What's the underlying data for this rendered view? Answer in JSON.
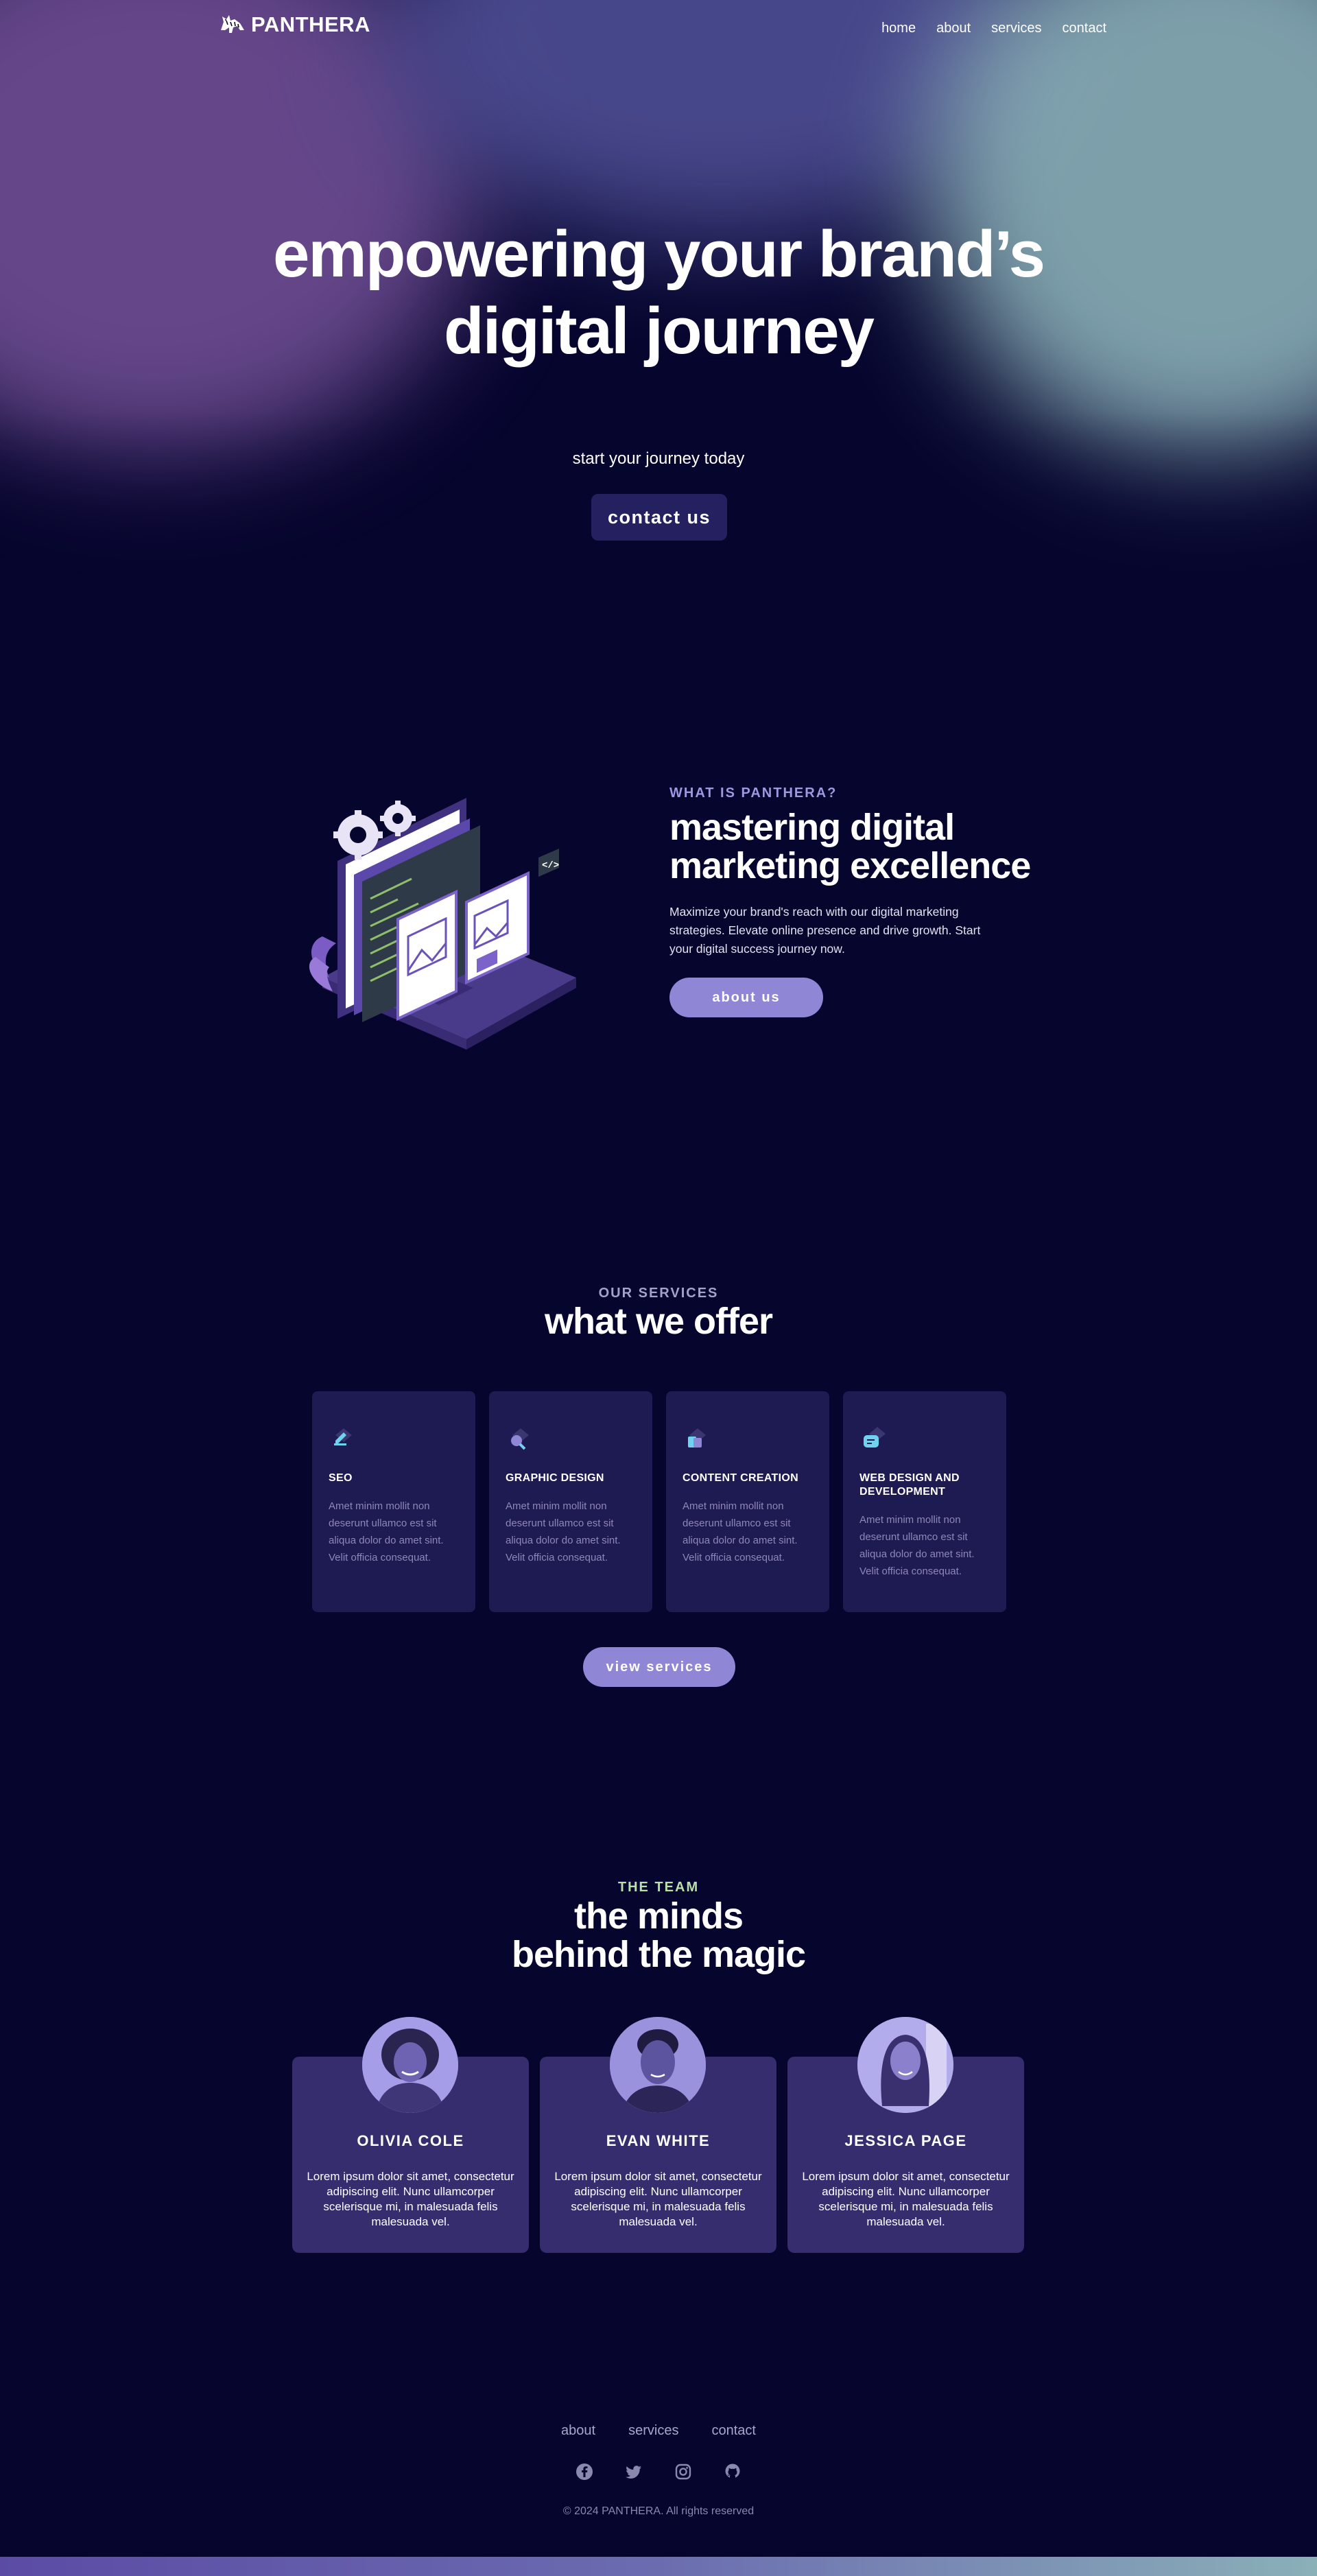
{
  "nav": {
    "brand": "PANTHERA",
    "links": [
      "home",
      "about",
      "services",
      "contact"
    ]
  },
  "hero": {
    "title_line1": "empowering your brand’s",
    "title_line2": "digital journey",
    "subtitle": "start your journey today",
    "cta": "contact us"
  },
  "about": {
    "eyebrow": "WHAT IS PANTHERA?",
    "title_line1": "mastering digital",
    "title_line2": "marketing excellence",
    "description": "Maximize your brand's reach with our digital marketing strategies. Elevate online presence and drive growth. Start your digital success journey now.",
    "cta": "about us"
  },
  "services": {
    "eyebrow": "OUR SERVICES",
    "title": "what we offer",
    "items": [
      {
        "title": "SEO",
        "icon": "pen-icon",
        "description": "Amet minim mollit non deserunt ullamco est sit aliqua dolor do amet sint. Velit officia consequat."
      },
      {
        "title": "GRAPHIC DESIGN",
        "icon": "magnifier-icon",
        "description": "Amet minim mollit non deserunt ullamco est sit aliqua dolor do amet sint. Velit officia consequat."
      },
      {
        "title": "CONTENT CREATION",
        "icon": "book-icon",
        "description": "Amet minim mollit non deserunt ullamco est sit aliqua dolor do amet sint. Velit officia consequat."
      },
      {
        "title": "WEB DESIGN AND DEVELOPMENT",
        "icon": "chat-icon",
        "description": "Amet minim mollit non deserunt ullamco est sit aliqua dolor do amet sint. Velit officia consequat."
      }
    ],
    "cta": "view services"
  },
  "team": {
    "eyebrow": "THE TEAM",
    "title_line1": "the minds",
    "title_line2": "behind the magic",
    "members": [
      {
        "name": "OLIVIA COLE",
        "bio": "Lorem ipsum dolor sit amet, consectetur adipiscing elit. Nunc ullamcorper scelerisque mi, in malesuada felis malesuada vel."
      },
      {
        "name": "EVAN WHITE",
        "bio": "Lorem ipsum dolor sit amet, consectetur adipiscing elit. Nunc ullamcorper scelerisque mi, in malesuada felis malesuada vel."
      },
      {
        "name": "JESSICA PAGE",
        "bio": "Lorem ipsum dolor sit amet, consectetur adipiscing elit. Nunc ullamcorper scelerisque mi, in malesuada felis malesuada vel."
      }
    ]
  },
  "footer": {
    "links": [
      "about",
      "services",
      "contact"
    ],
    "social": [
      "facebook-icon",
      "twitter-icon",
      "instagram-icon",
      "github-icon"
    ],
    "copyright": "© 2024 PANTHERA. All rights reserved"
  },
  "colors": {
    "background": "#06052e",
    "accent_button": "#8f87d6",
    "card": "#1e1a52",
    "team_card": "#352d6e",
    "eyebrow_purple": "#9d98e0",
    "eyebrow_green": "#b8e0a8"
  }
}
